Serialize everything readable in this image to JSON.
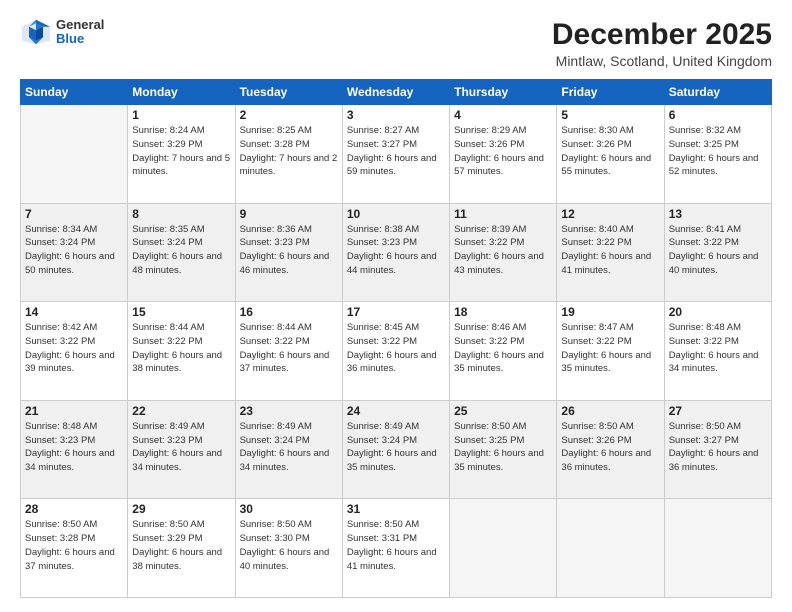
{
  "logo": {
    "general": "General",
    "blue": "Blue"
  },
  "title": "December 2025",
  "location": "Mintlaw, Scotland, United Kingdom",
  "days_of_week": [
    "Sunday",
    "Monday",
    "Tuesday",
    "Wednesday",
    "Thursday",
    "Friday",
    "Saturday"
  ],
  "weeks": [
    [
      {
        "day": "",
        "empty": true
      },
      {
        "day": "1",
        "rise": "8:24 AM",
        "set": "3:29 PM",
        "daylight": "7 hours and 5 minutes."
      },
      {
        "day": "2",
        "rise": "8:25 AM",
        "set": "3:28 PM",
        "daylight": "7 hours and 2 minutes."
      },
      {
        "day": "3",
        "rise": "8:27 AM",
        "set": "3:27 PM",
        "daylight": "6 hours and 59 minutes."
      },
      {
        "day": "4",
        "rise": "8:29 AM",
        "set": "3:26 PM",
        "daylight": "6 hours and 57 minutes."
      },
      {
        "day": "5",
        "rise": "8:30 AM",
        "set": "3:26 PM",
        "daylight": "6 hours and 55 minutes."
      },
      {
        "day": "6",
        "rise": "8:32 AM",
        "set": "3:25 PM",
        "daylight": "6 hours and 52 minutes."
      }
    ],
    [
      {
        "day": "7",
        "rise": "8:34 AM",
        "set": "3:24 PM",
        "daylight": "6 hours and 50 minutes."
      },
      {
        "day": "8",
        "rise": "8:35 AM",
        "set": "3:24 PM",
        "daylight": "6 hours and 48 minutes."
      },
      {
        "day": "9",
        "rise": "8:36 AM",
        "set": "3:23 PM",
        "daylight": "6 hours and 46 minutes."
      },
      {
        "day": "10",
        "rise": "8:38 AM",
        "set": "3:23 PM",
        "daylight": "6 hours and 44 minutes."
      },
      {
        "day": "11",
        "rise": "8:39 AM",
        "set": "3:22 PM",
        "daylight": "6 hours and 43 minutes."
      },
      {
        "day": "12",
        "rise": "8:40 AM",
        "set": "3:22 PM",
        "daylight": "6 hours and 41 minutes."
      },
      {
        "day": "13",
        "rise": "8:41 AM",
        "set": "3:22 PM",
        "daylight": "6 hours and 40 minutes."
      }
    ],
    [
      {
        "day": "14",
        "rise": "8:42 AM",
        "set": "3:22 PM",
        "daylight": "6 hours and 39 minutes."
      },
      {
        "day": "15",
        "rise": "8:44 AM",
        "set": "3:22 PM",
        "daylight": "6 hours and 38 minutes."
      },
      {
        "day": "16",
        "rise": "8:44 AM",
        "set": "3:22 PM",
        "daylight": "6 hours and 37 minutes."
      },
      {
        "day": "17",
        "rise": "8:45 AM",
        "set": "3:22 PM",
        "daylight": "6 hours and 36 minutes."
      },
      {
        "day": "18",
        "rise": "8:46 AM",
        "set": "3:22 PM",
        "daylight": "6 hours and 35 minutes."
      },
      {
        "day": "19",
        "rise": "8:47 AM",
        "set": "3:22 PM",
        "daylight": "6 hours and 35 minutes."
      },
      {
        "day": "20",
        "rise": "8:48 AM",
        "set": "3:22 PM",
        "daylight": "6 hours and 34 minutes."
      }
    ],
    [
      {
        "day": "21",
        "rise": "8:48 AM",
        "set": "3:23 PM",
        "daylight": "6 hours and 34 minutes."
      },
      {
        "day": "22",
        "rise": "8:49 AM",
        "set": "3:23 PM",
        "daylight": "6 hours and 34 minutes."
      },
      {
        "day": "23",
        "rise": "8:49 AM",
        "set": "3:24 PM",
        "daylight": "6 hours and 34 minutes."
      },
      {
        "day": "24",
        "rise": "8:49 AM",
        "set": "3:24 PM",
        "daylight": "6 hours and 35 minutes."
      },
      {
        "day": "25",
        "rise": "8:50 AM",
        "set": "3:25 PM",
        "daylight": "6 hours and 35 minutes."
      },
      {
        "day": "26",
        "rise": "8:50 AM",
        "set": "3:26 PM",
        "daylight": "6 hours and 36 minutes."
      },
      {
        "day": "27",
        "rise": "8:50 AM",
        "set": "3:27 PM",
        "daylight": "6 hours and 36 minutes."
      }
    ],
    [
      {
        "day": "28",
        "rise": "8:50 AM",
        "set": "3:28 PM",
        "daylight": "6 hours and 37 minutes."
      },
      {
        "day": "29",
        "rise": "8:50 AM",
        "set": "3:29 PM",
        "daylight": "6 hours and 38 minutes."
      },
      {
        "day": "30",
        "rise": "8:50 AM",
        "set": "3:30 PM",
        "daylight": "6 hours and 40 minutes."
      },
      {
        "day": "31",
        "rise": "8:50 AM",
        "set": "3:31 PM",
        "daylight": "6 hours and 41 minutes."
      },
      {
        "day": "",
        "empty": true
      },
      {
        "day": "",
        "empty": true
      },
      {
        "day": "",
        "empty": true
      }
    ]
  ],
  "labels": {
    "sunrise": "Sunrise:",
    "sunset": "Sunset:",
    "daylight": "Daylight:"
  }
}
